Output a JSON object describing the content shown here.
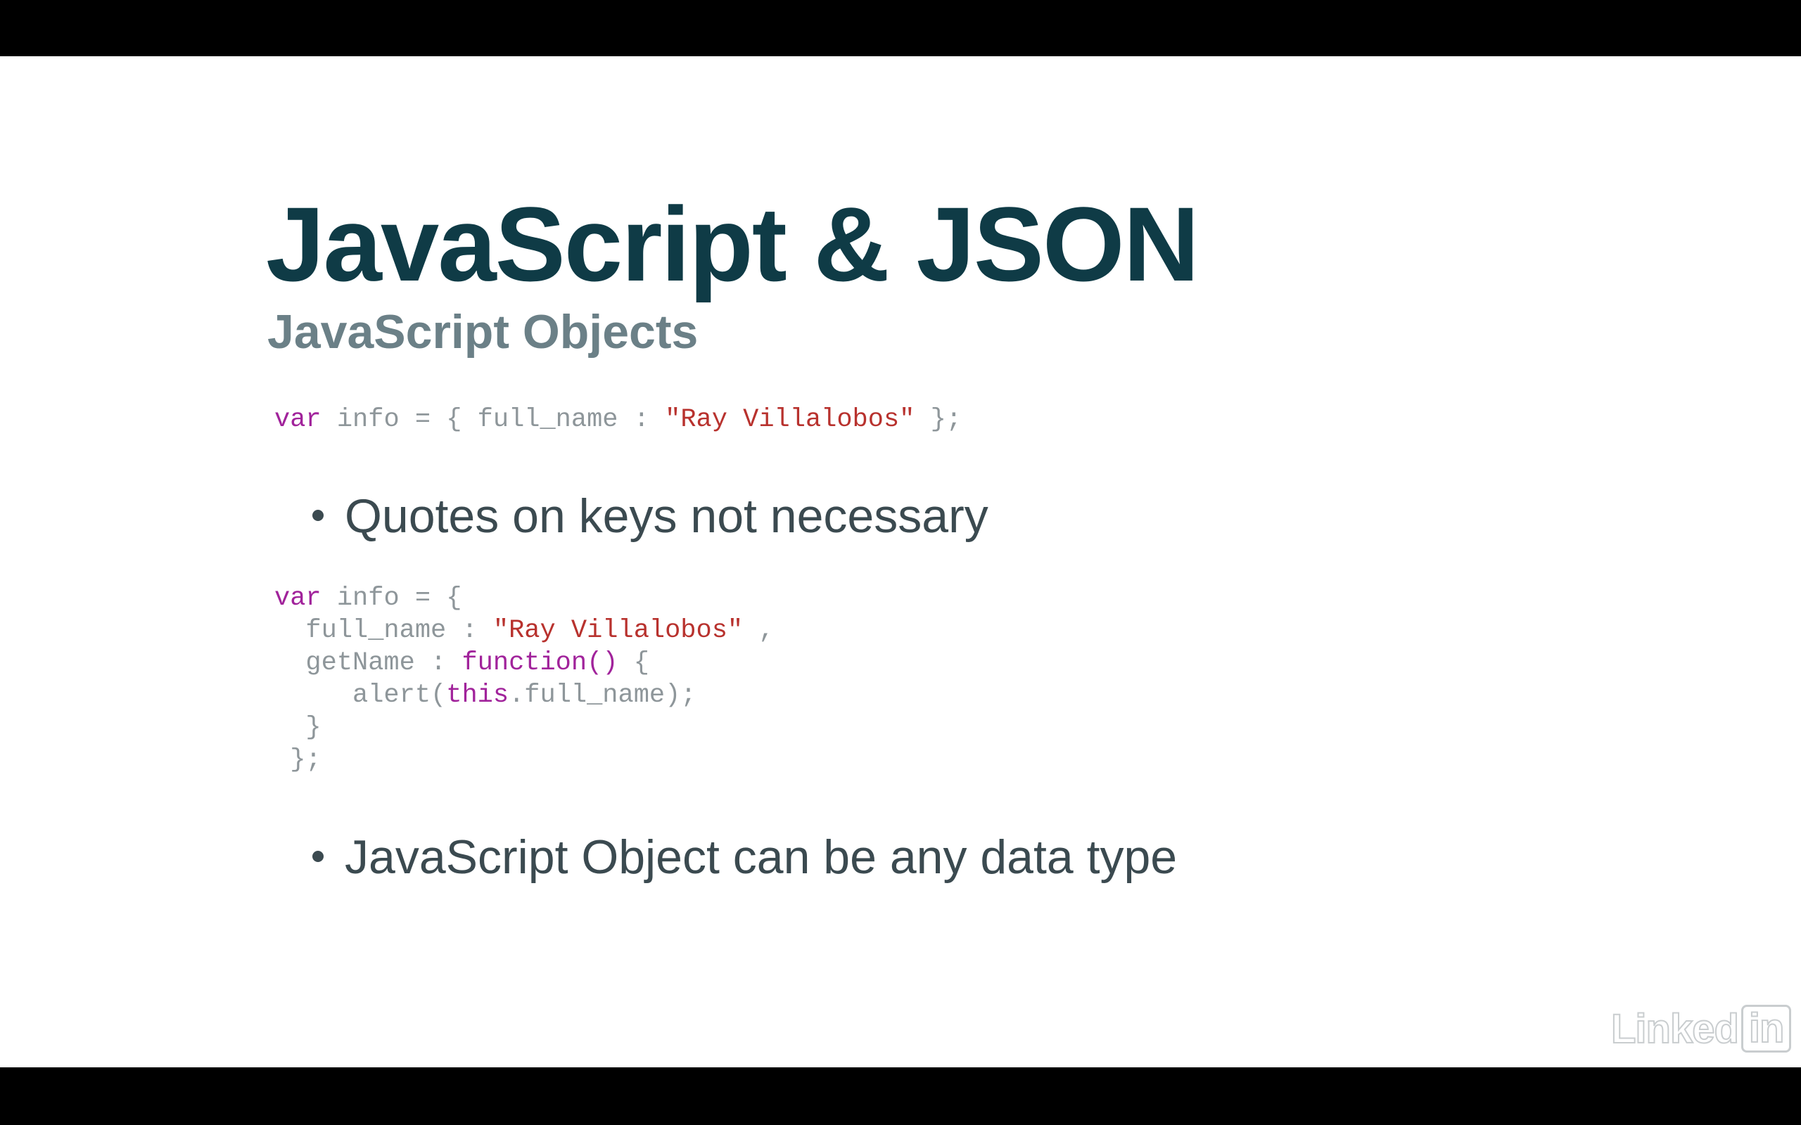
{
  "slide": {
    "title": "JavaScript & JSON",
    "subtitle": "JavaScript Objects",
    "code_sample_1": {
      "line_1": {
        "kw_var": "var",
        "text_a": " info = { full_name : ",
        "str": "\"Ray Villalobos\"",
        "text_b": " };"
      }
    },
    "bullet_1": "Quotes on keys not necessary",
    "code_sample_2": {
      "line_1": {
        "kw_var": "var",
        "text": " info = {"
      },
      "line_2": {
        "text_a": "  full_name : ",
        "str": "\"Ray Villalobos\"",
        "text_b": " ,"
      },
      "line_3": {
        "text_a": "  getName : ",
        "kw_function": "function()",
        "text_b": " {"
      },
      "line_4": {
        "text_a": "     alert(",
        "kw_this": "this",
        "text_b": ".full_name);"
      },
      "line_5": {
        "text": "  }"
      },
      "line_6": {
        "text": " };"
      }
    },
    "bullet_2": "JavaScript Object can be any data type"
  },
  "watermark": {
    "brand_text": "Linked",
    "brand_box_text": "in"
  },
  "colors": {
    "title": "#0f3b46",
    "subtitle": "#6b8087",
    "code_plain": "#8e969a",
    "code_keyword": "#a1239b",
    "code_string": "#b8322e",
    "bullet_text": "#3b4a50",
    "background": "#ffffff",
    "letterbox": "#000000"
  }
}
